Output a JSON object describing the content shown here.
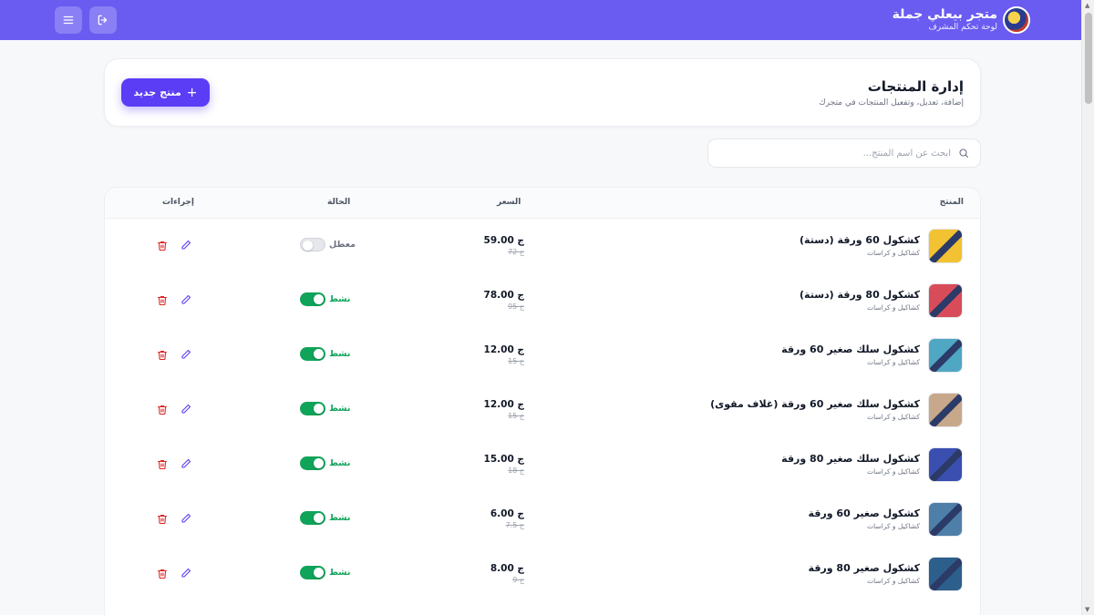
{
  "header": {
    "store_name": "متجر بيعلي جملة",
    "subtitle": "لوحة تحكم المشرف",
    "accent": "#6a5cf1"
  },
  "page": {
    "title": "إدارة المنتجات",
    "subtitle": "إضافة، تعديل، وتفعيل المنتجات في متجرك",
    "new_button": "منتج جديد"
  },
  "search": {
    "placeholder": "ابحث عن اسم المنتج..."
  },
  "table": {
    "headers": {
      "product": "المنتج",
      "price": "السعر",
      "status": "الحالة",
      "actions": "إجراءات"
    },
    "rows": [
      {
        "name": "كشكول 60 ورقة (دستة)",
        "category": "كشاكيل و كراسات",
        "price": "59.00 ج",
        "old_price": "72 ج",
        "status": "معطل",
        "active": false,
        "thumb": "#f2c232"
      },
      {
        "name": "كشكول 80 ورقة (دستة)",
        "category": "كشاكيل و كراسات",
        "price": "78.00 ج",
        "old_price": "95 ج",
        "status": "نشط",
        "active": true,
        "thumb": "#d84c5a"
      },
      {
        "name": "كشكول سلك صغير 60 ورقة",
        "category": "كشاكيل و كراسات",
        "price": "12.00 ج",
        "old_price": "15 ج",
        "status": "نشط",
        "active": true,
        "thumb": "#4fa7c4"
      },
      {
        "name": "كشكول سلك صغير 60 ورقة (غلاف مقوى)",
        "category": "كشاكيل و كراسات",
        "price": "12.00 ج",
        "old_price": "15 ج",
        "status": "نشط",
        "active": true,
        "thumb": "#c8a88a"
      },
      {
        "name": "كشكول سلك صغير 80 ورقة",
        "category": "كشاكيل و كراسات",
        "price": "15.00 ج",
        "old_price": "18 ج",
        "status": "نشط",
        "active": true,
        "thumb": "#3a4fb0"
      },
      {
        "name": "كشكول صغير 60 ورقة",
        "category": "كشاكيل و كراسات",
        "price": "6.00 ج",
        "old_price": "7.5 ج",
        "status": "نشط",
        "active": true,
        "thumb": "#4d7fa8"
      },
      {
        "name": "كشكول صغير 80 ورقة",
        "category": "كشاكيل و كراسات",
        "price": "8.00 ج",
        "old_price": "9 ج",
        "status": "نشط",
        "active": true,
        "thumb": "#2d5f8c"
      }
    ]
  },
  "colors": {
    "active_green": "#10a35a",
    "inactive_gray": "#d1d5db",
    "edit_purple": "#5b3df5",
    "delete_red": "#dc2626"
  }
}
